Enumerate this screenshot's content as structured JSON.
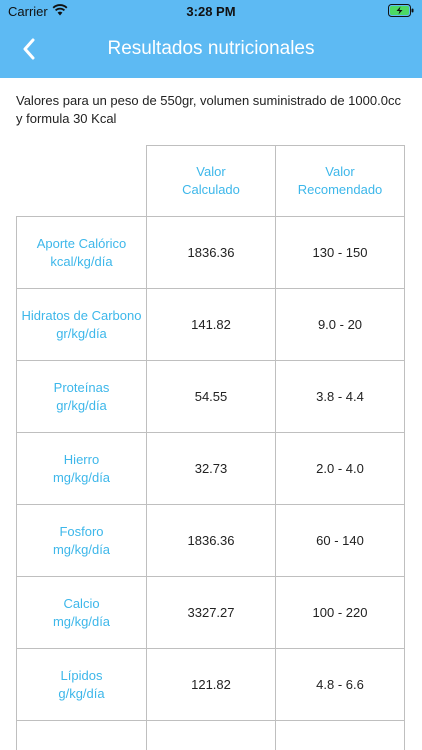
{
  "status_bar": {
    "carrier": "Carrier",
    "time": "3:28 PM",
    "wifi_icon": "wifi-icon",
    "battery_icon": "battery-charging-icon"
  },
  "nav": {
    "title": "Resultados nutricionales",
    "back_icon": "chevron-left-icon"
  },
  "intro": "Valores para un peso de 550gr, volumen suministrado de 1000.0cc y formula 30 Kcal",
  "table": {
    "headers": [
      {
        "line1": "Valor",
        "line2": "Calculado"
      },
      {
        "line1": "Valor",
        "line2": "Recomendado"
      }
    ],
    "rows": [
      {
        "name": "Aporte Calórico",
        "unit": "kcal/kg/día",
        "calculado": "1836.36",
        "recomendado": "130 - 150"
      },
      {
        "name": "Hidratos de Carbono",
        "unit": "gr/kg/día",
        "calculado": "141.82",
        "recomendado": "9.0 - 20"
      },
      {
        "name": "Proteínas",
        "unit": "gr/kg/día",
        "calculado": "54.55",
        "recomendado": "3.8 - 4.4"
      },
      {
        "name": "Hierro",
        "unit": "mg/kg/día",
        "calculado": "32.73",
        "recomendado": "2.0 - 4.0"
      },
      {
        "name": "Fosforo",
        "unit": "mg/kg/día",
        "calculado": "1836.36",
        "recomendado": "60 - 140"
      },
      {
        "name": "Calcio",
        "unit": "mg/kg/día",
        "calculado": "3327.27",
        "recomendado": "100 - 220"
      },
      {
        "name": "Lípidos",
        "unit": "g/kg/día",
        "calculado": "121.82",
        "recomendado": "4.8 - 6.6"
      }
    ]
  },
  "colors": {
    "header": "#5dbaf3",
    "accent": "#3db7ea",
    "border": "#bfbfbf"
  }
}
